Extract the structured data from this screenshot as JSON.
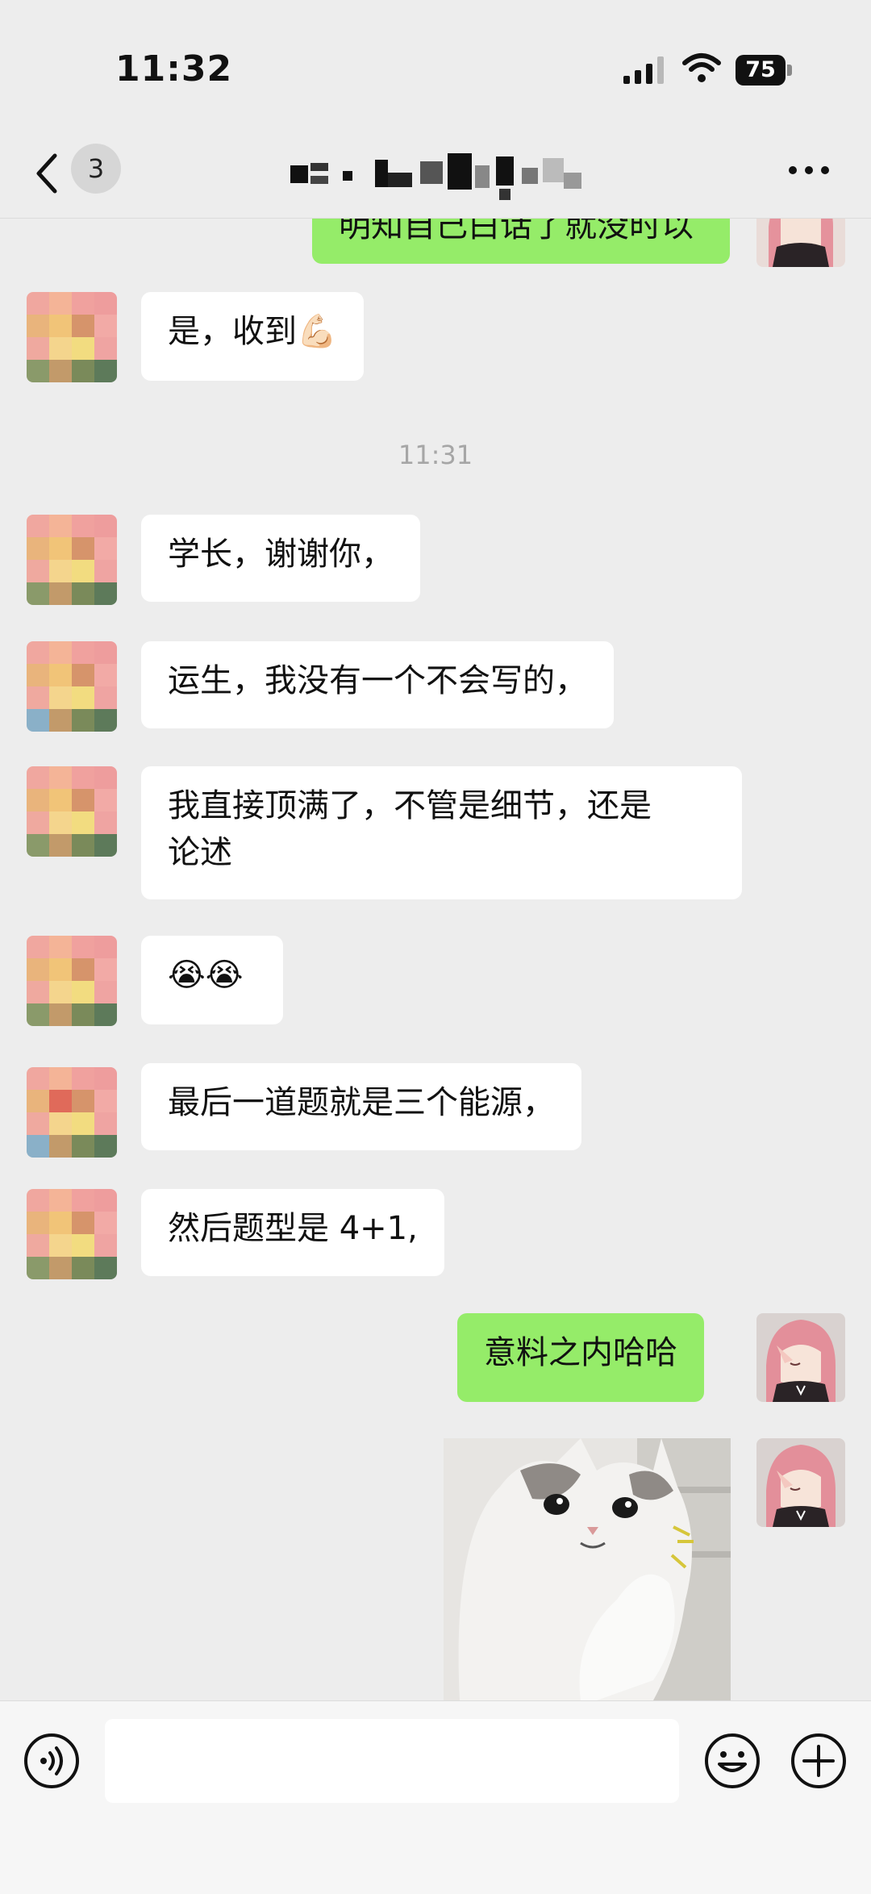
{
  "status_bar": {
    "time": "11:32",
    "battery": "75"
  },
  "header": {
    "unread_count": "3"
  },
  "timestamp": "11:31",
  "messages": {
    "partial_sent": "明知自己白话了就没时以",
    "m1": "是，收到💪🏻",
    "m2": "学长，谢谢你，",
    "m3": "运生，我没有一个不会写的，",
    "m4_line1": "我直接顶满了，不管是细节，还是",
    "m4_line2": "论述",
    "m5": "😭😭",
    "m6": "最后一道题就是三个能源，",
    "m7": "然后题型是 4+1,",
    "m8": "意料之内哈哈"
  },
  "input": {
    "value": "",
    "placeholder": ""
  },
  "icons": {
    "back": "chevron-left-icon",
    "more": "more-dots-icon",
    "voice": "voice-icon",
    "emoji": "emoji-icon",
    "plus": "plus-icon"
  },
  "colors": {
    "background": "#ededed",
    "sent_bubble": "#95ec69",
    "received_bubble": "#ffffff"
  }
}
